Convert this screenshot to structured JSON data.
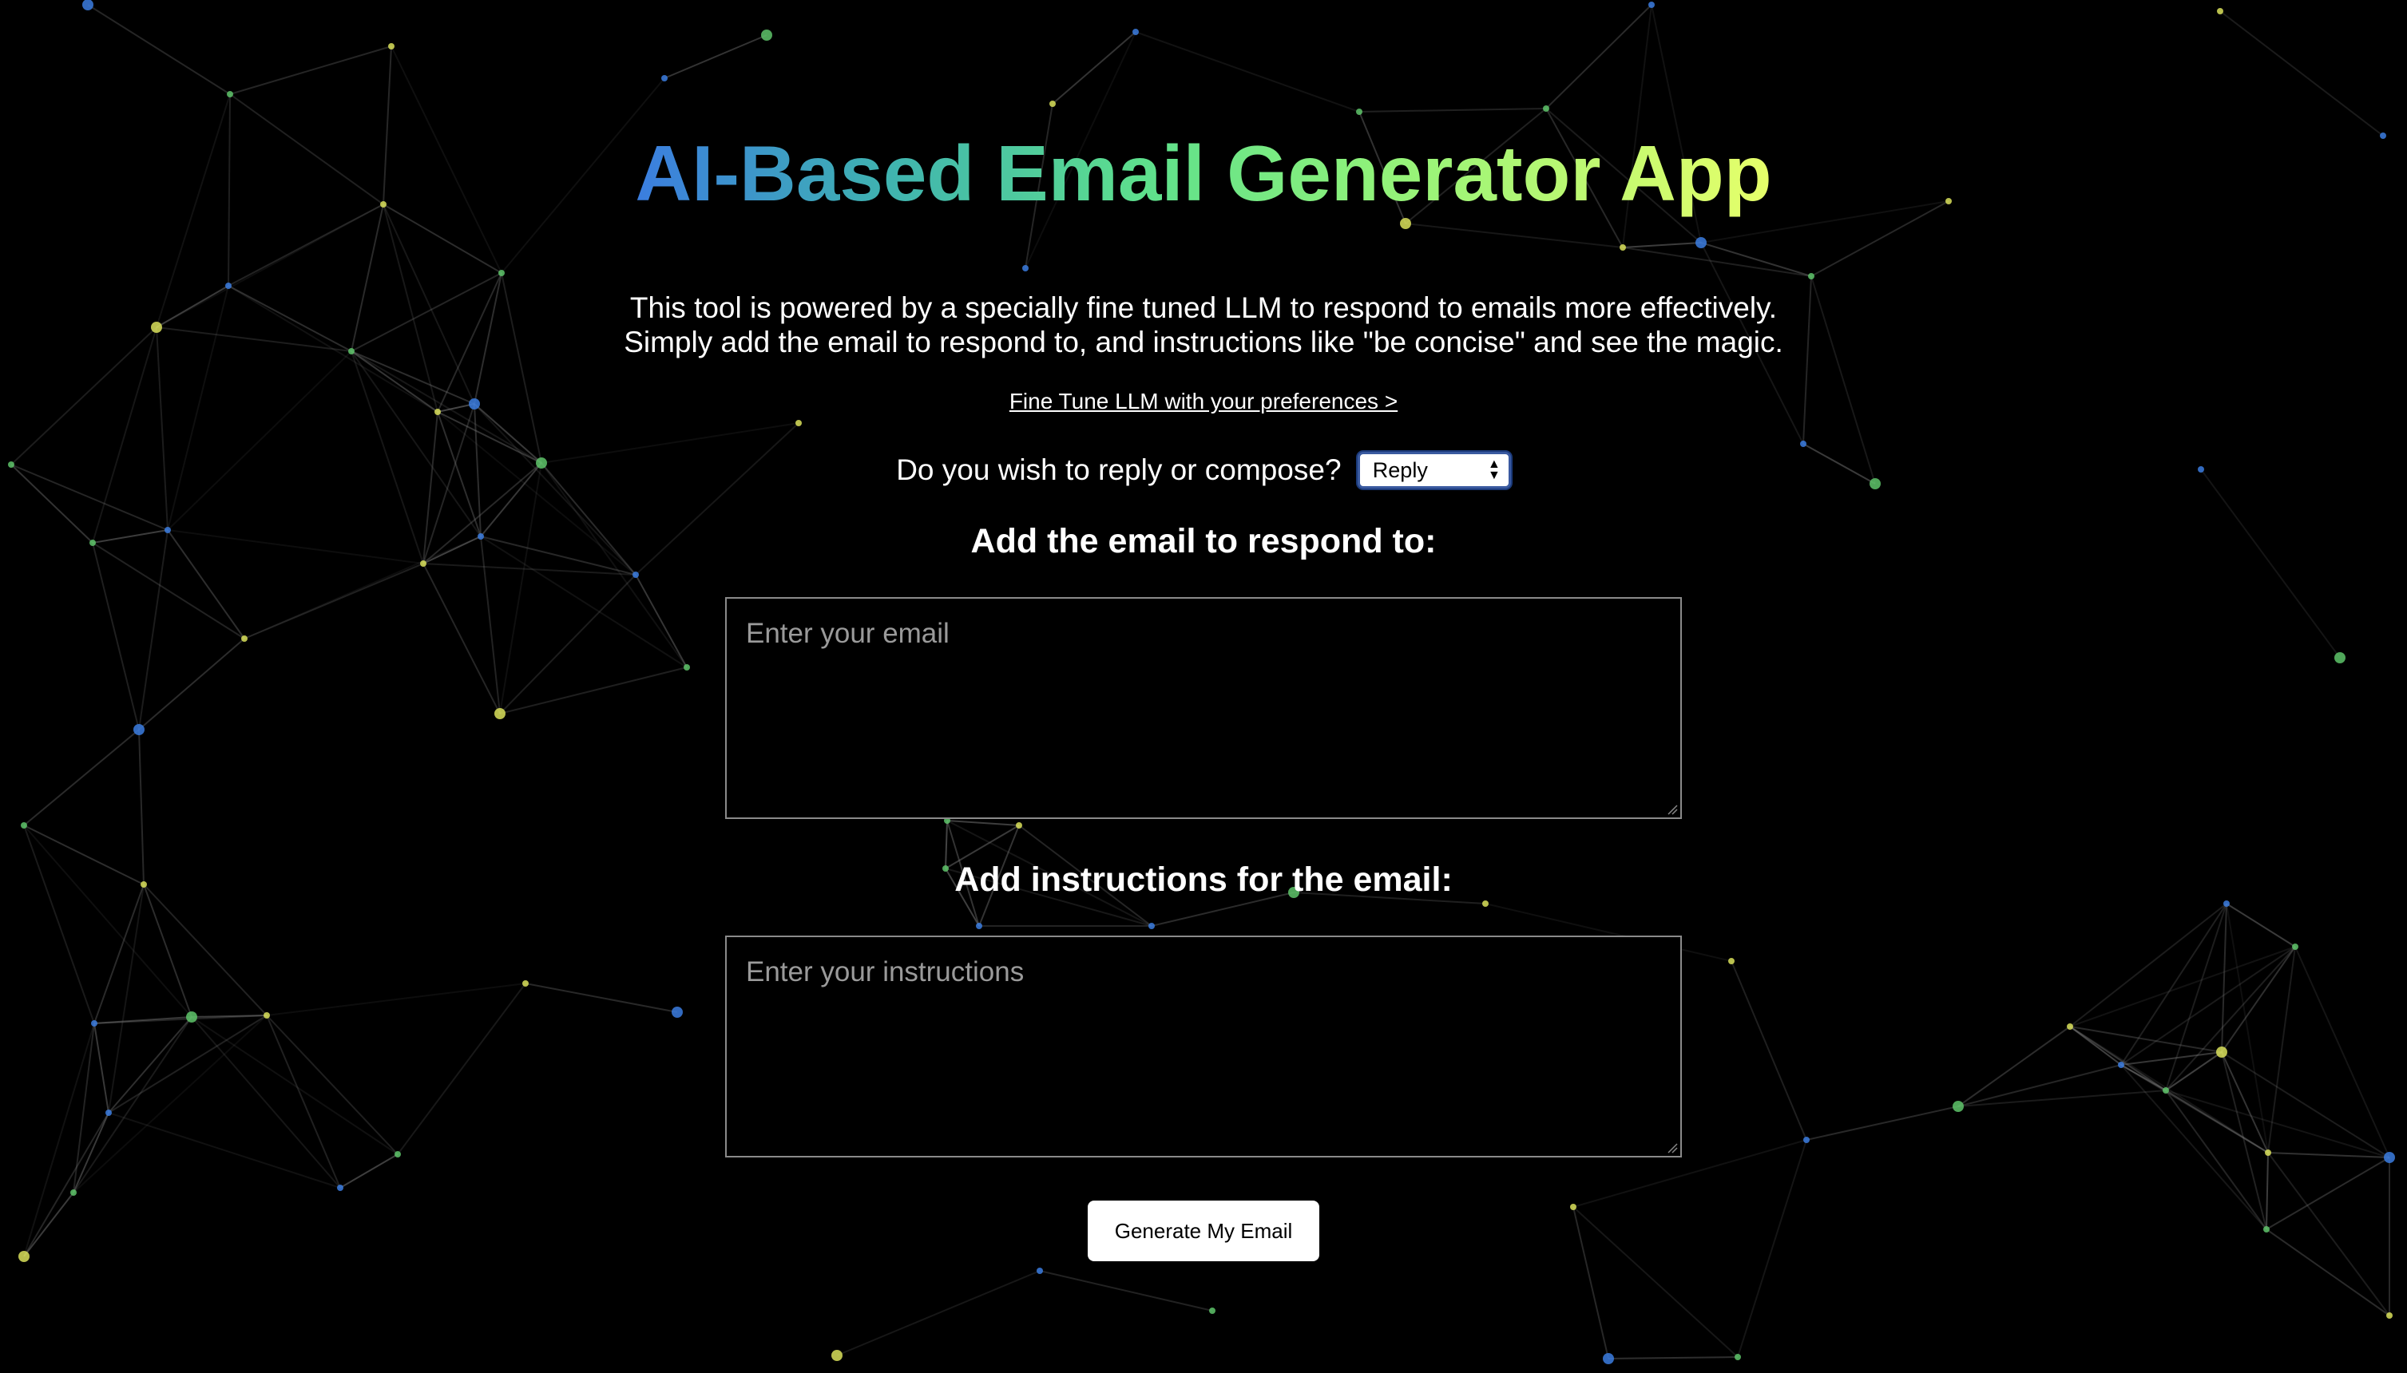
{
  "header": {
    "title": "AI-Based Email Generator App"
  },
  "intro": {
    "line1": "This tool is powered by a specially fine tuned LLM to respond to emails more effectively.",
    "line2": "Simply add the email to respond to, and instructions like \"be concise\" and see the magic.",
    "fine_tune_link": "Fine Tune LLM with your preferences >"
  },
  "mode": {
    "question": "Do you wish to reply or compose?",
    "selected": "Reply"
  },
  "email_section": {
    "heading": "Add the email to respond to:",
    "placeholder": "Enter your email"
  },
  "instructions_section": {
    "heading": "Add instructions for the email:",
    "placeholder": "Enter your instructions"
  },
  "actions": {
    "generate_label": "Generate My Email"
  },
  "theme": {
    "background": "#000000",
    "node_colors": [
      "#3b7de0",
      "#5ec46a",
      "#d9e05a"
    ]
  }
}
